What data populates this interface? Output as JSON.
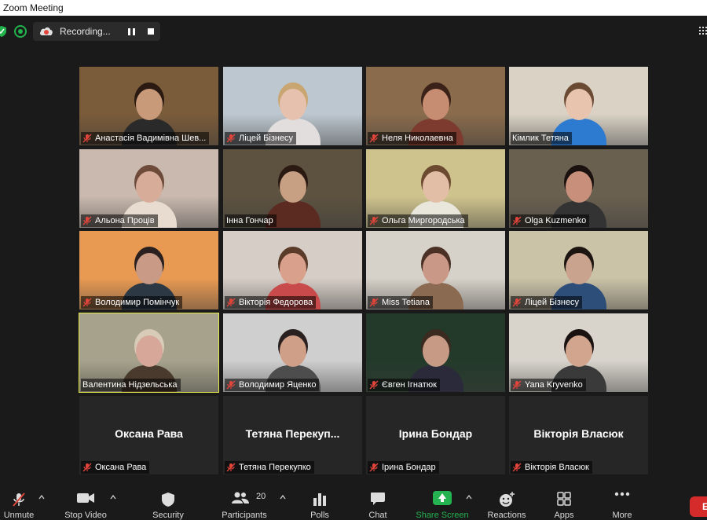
{
  "window": {
    "title": "Zoom Meeting"
  },
  "recording": {
    "label": "Recording..."
  },
  "tiles": [
    {
      "name": "Анастасія Вадимівна Шев...",
      "muted": true,
      "kind": "video",
      "bg": "#7a5b3a",
      "skin": "#c89a7a",
      "shirt": "#2a2a2a",
      "hair": "#2b1a12"
    },
    {
      "name": "Ліцей Бізнесу",
      "muted": true,
      "kind": "video",
      "bg": "#bdc7cf",
      "skin": "#e6c2ae",
      "shirt": "#e2dede",
      "hair": "#c9a572"
    },
    {
      "name": "Неля Николаевна",
      "muted": true,
      "kind": "video",
      "bg": "#8a6b4c",
      "skin": "#c78d72",
      "shirt": "#7c3b2e",
      "hair": "#3a2218"
    },
    {
      "name": "Кімлик Тетяна",
      "muted": false,
      "kind": "video",
      "bg": "#d9d2c5",
      "skin": "#e8c3ae",
      "shirt": "#2c7bd0",
      "hair": "#6b4a33"
    },
    {
      "name": "Альона Проців",
      "muted": true,
      "kind": "video",
      "bg": "#c9b9ae",
      "skin": "#d7ad9a",
      "shirt": "#e7dccf",
      "hair": "#6d4a3a"
    },
    {
      "name": "Інна Гончар",
      "muted": false,
      "kind": "video",
      "bg": "#5d5240",
      "skin": "#c7a084",
      "shirt": "#5b2a20",
      "hair": "#2a1a12"
    },
    {
      "name": "Ольга Миргородська",
      "muted": true,
      "kind": "video",
      "bg": "#cfc38d",
      "skin": "#e2bea6",
      "shirt": "#e9e6dc",
      "hair": "#6b4a30"
    },
    {
      "name": "Olga Kuzmenko",
      "muted": true,
      "kind": "video",
      "bg": "#6a6050",
      "skin": "#c8907a",
      "shirt": "#333333",
      "hair": "#1b1210"
    },
    {
      "name": "Володимир Помінчук",
      "muted": true,
      "kind": "video",
      "bg": "#e99a52",
      "skin": "#c99a86",
      "shirt": "#2d3845",
      "hair": "#2b2020"
    },
    {
      "name": "Вікторія Федорова",
      "muted": true,
      "kind": "video",
      "bg": "#d6cdc6",
      "skin": "#d9a08c",
      "shirt": "#c94a4a",
      "hair": "#5a3a28"
    },
    {
      "name": "Miss Tetiana",
      "muted": true,
      "kind": "video",
      "bg": "#d7d2c9",
      "skin": "#c99886",
      "shirt": "#8a6a50",
      "hair": "#4a3025"
    },
    {
      "name": "Ліцей Бізнесу",
      "muted": true,
      "kind": "video",
      "bg": "#cbc3a8",
      "skin": "#c9a38d",
      "shirt": "#2e4e7a",
      "hair": "#1b1410"
    },
    {
      "name": "Валентина Нідзельська",
      "muted": false,
      "kind": "video",
      "active": true,
      "bg": "#a6a28c",
      "skin": "#d7a89a",
      "shirt": "#4a3a2e",
      "hair": "#d8cbb8"
    },
    {
      "name": "Володимир Яценко",
      "muted": true,
      "kind": "video",
      "bg": "#cfcfcf",
      "skin": "#cf9f88",
      "shirt": "#4d4d4d",
      "hair": "#2a2020"
    },
    {
      "name": "Євген Ігнатюк",
      "muted": true,
      "kind": "video",
      "bg": "#233a2a",
      "skin": "#c79a86",
      "shirt": "#2a2a3a",
      "hair": "#3a2a20"
    },
    {
      "name": "Yana Kryvenko",
      "muted": true,
      "kind": "video",
      "bg": "#d8d4cc",
      "skin": "#d2a58f",
      "shirt": "#3a3a3a",
      "hair": "#1a1210"
    },
    {
      "name": "Оксана Рава",
      "muted": true,
      "kind": "name",
      "display": "Оксана Рава"
    },
    {
      "name": "Тетяна Перекупко",
      "muted": true,
      "kind": "name",
      "display": "Тетяна  Перекуп..."
    },
    {
      "name": "Ірина Бондар",
      "muted": true,
      "kind": "name",
      "display": "Ірина Бондар"
    },
    {
      "name": "Вікторія Власюк",
      "muted": true,
      "kind": "name",
      "display": "Вікторія Власюк"
    }
  ],
  "toolbar": {
    "unmute": "Unmute",
    "stop_video": "Stop Video",
    "security": "Security",
    "participants": "Participants",
    "participants_count": "20",
    "polls": "Polls",
    "chat": "Chat",
    "share_screen": "Share Screen",
    "reactions": "Reactions",
    "apps": "Apps",
    "more": "More",
    "end": "E"
  },
  "colors": {
    "accent_green": "#24b350",
    "active_speaker": "#e4e84a",
    "end_red": "#d52b2b",
    "muted_red": "#e0443a"
  }
}
